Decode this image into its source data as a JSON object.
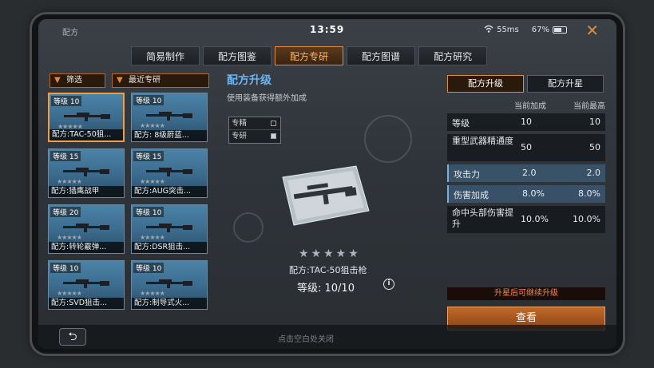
{
  "app": {
    "title": "配方"
  },
  "status": {
    "time": "13:59",
    "ping": "55ms",
    "battery": "67%"
  },
  "tabs": [
    {
      "label": "简易制作",
      "active": false
    },
    {
      "label": "配方图鉴",
      "active": false
    },
    {
      "label": "配方专研",
      "active": true
    },
    {
      "label": "配方图谱",
      "active": false
    },
    {
      "label": "配方研究",
      "active": false
    }
  ],
  "filters": {
    "filter_label": "筛选",
    "sort_label": "最近专研"
  },
  "recipes": [
    {
      "level": "等级 10",
      "name": "配方:TAC-50狙...",
      "selected": true
    },
    {
      "level": "等级 10",
      "name": "配方: 8级蔚蓝...",
      "selected": false
    },
    {
      "level": "等级 15",
      "name": "配方:猎鹰战甲",
      "selected": false
    },
    {
      "level": "等级 15",
      "name": "配方:AUG突击...",
      "selected": false
    },
    {
      "level": "等级 20",
      "name": "配方:转轮霰弹...",
      "selected": false
    },
    {
      "level": "等级 10",
      "name": "配方:DSR狙击...",
      "selected": false
    },
    {
      "level": "等级 10",
      "name": "配方:SVD狙击...",
      "selected": false
    },
    {
      "level": "等级 10",
      "name": "配方:制导式火...",
      "selected": false
    }
  ],
  "detail": {
    "title": "配方升级",
    "subtitle": "使用装备获得额外加成",
    "options": [
      {
        "label": "专精",
        "checked": false
      },
      {
        "label": "专研",
        "checked": true
      }
    ],
    "stars": "★★★★★",
    "item_name": "配方:TAC-50狙击枪",
    "level_text": "等级: 10/10"
  },
  "upgrade": {
    "subtabs": [
      {
        "label": "配方升级",
        "active": true
      },
      {
        "label": "配方升星",
        "active": false
      }
    ],
    "col_current": "当前加成",
    "col_max": "当前最高",
    "stats": [
      {
        "label": "等级",
        "current": "10",
        "max": "10",
        "highlight": false,
        "tall": false
      },
      {
        "label": "重型武器精通度",
        "current": "50",
        "max": "50",
        "highlight": false,
        "tall": true
      },
      {
        "label": "攻击力",
        "current": "2.0",
        "max": "2.0",
        "highlight": true,
        "tall": false
      },
      {
        "label": "伤害加成",
        "current": "8.0%",
        "max": "8.0%",
        "highlight": true,
        "tall": false
      },
      {
        "label": "命中头部伤害提升",
        "current": "10.0%",
        "max": "10.0%",
        "highlight": false,
        "tall": true
      }
    ],
    "note": "升星后可继续升级",
    "view_label": "查看"
  },
  "footer": {
    "hint": "点击空白处关闭"
  },
  "colors": {
    "accent": "#e08a3a",
    "title_blue": "#6cb4f0",
    "card_blue": "#4b83a8"
  }
}
